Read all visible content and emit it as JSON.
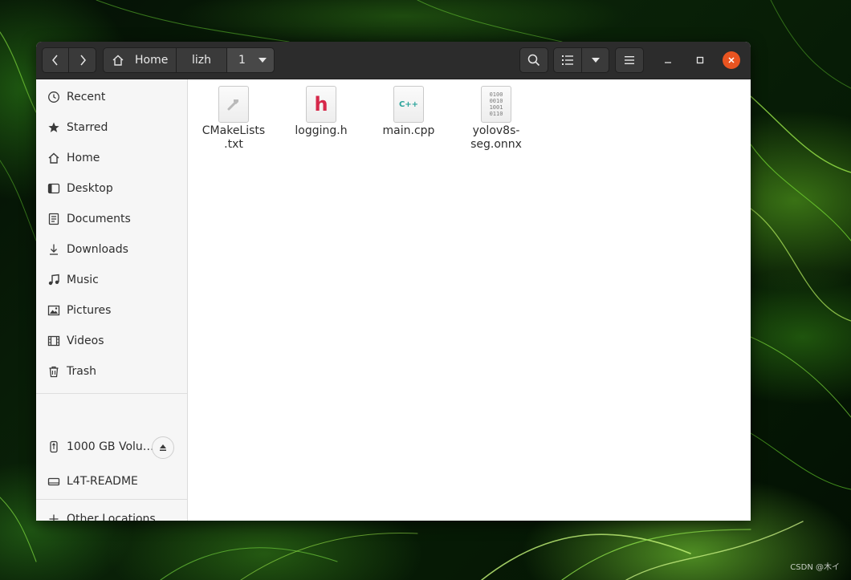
{
  "nav": {
    "back_icon": "chevron-left-icon",
    "forward_icon": "chevron-right-icon"
  },
  "path": {
    "home_label": "Home",
    "segment_1": "lizh",
    "current": "1"
  },
  "sidebar": {
    "places": [
      {
        "label": "Recent",
        "icon": "clock-icon"
      },
      {
        "label": "Starred",
        "icon": "star-icon"
      },
      {
        "label": "Home",
        "icon": "home-icon"
      },
      {
        "label": "Desktop",
        "icon": "desktop-icon"
      },
      {
        "label": "Documents",
        "icon": "document-icon"
      },
      {
        "label": "Downloads",
        "icon": "download-icon"
      },
      {
        "label": "Music",
        "icon": "music-icon"
      },
      {
        "label": "Pictures",
        "icon": "picture-icon"
      },
      {
        "label": "Videos",
        "icon": "video-icon"
      },
      {
        "label": "Trash",
        "icon": "trash-icon"
      }
    ],
    "devices": [
      {
        "label": "1000 GB Volu…",
        "icon": "usb-drive-icon"
      },
      {
        "label": "L4T-README",
        "icon": "drive-icon"
      }
    ],
    "other_locations": "Other Locations"
  },
  "files": [
    {
      "name_line1": "CMakeLists",
      "name_line2": ".txt",
      "icon": "cmake-script-icon"
    },
    {
      "name_line1": "logging.h",
      "name_line2": "",
      "icon": "header-file-icon",
      "glyph": "h"
    },
    {
      "name_line1": "main.cpp",
      "name_line2": "",
      "icon": "cpp-file-icon",
      "glyph": "C++"
    },
    {
      "name_line1": "yolov8s-",
      "name_line2": "seg.onnx",
      "icon": "binary-file-icon",
      "glyph_lines": [
        "0100",
        "0010",
        "1001",
        "0110"
      ]
    }
  ],
  "watermark": "CSDN @木イ",
  "colors": {
    "headerbar": "#2c2c2c",
    "close_button": "#e95420",
    "header_file_glyph": "#d6284a",
    "cpp_file_glyph": "#2aa39a"
  }
}
